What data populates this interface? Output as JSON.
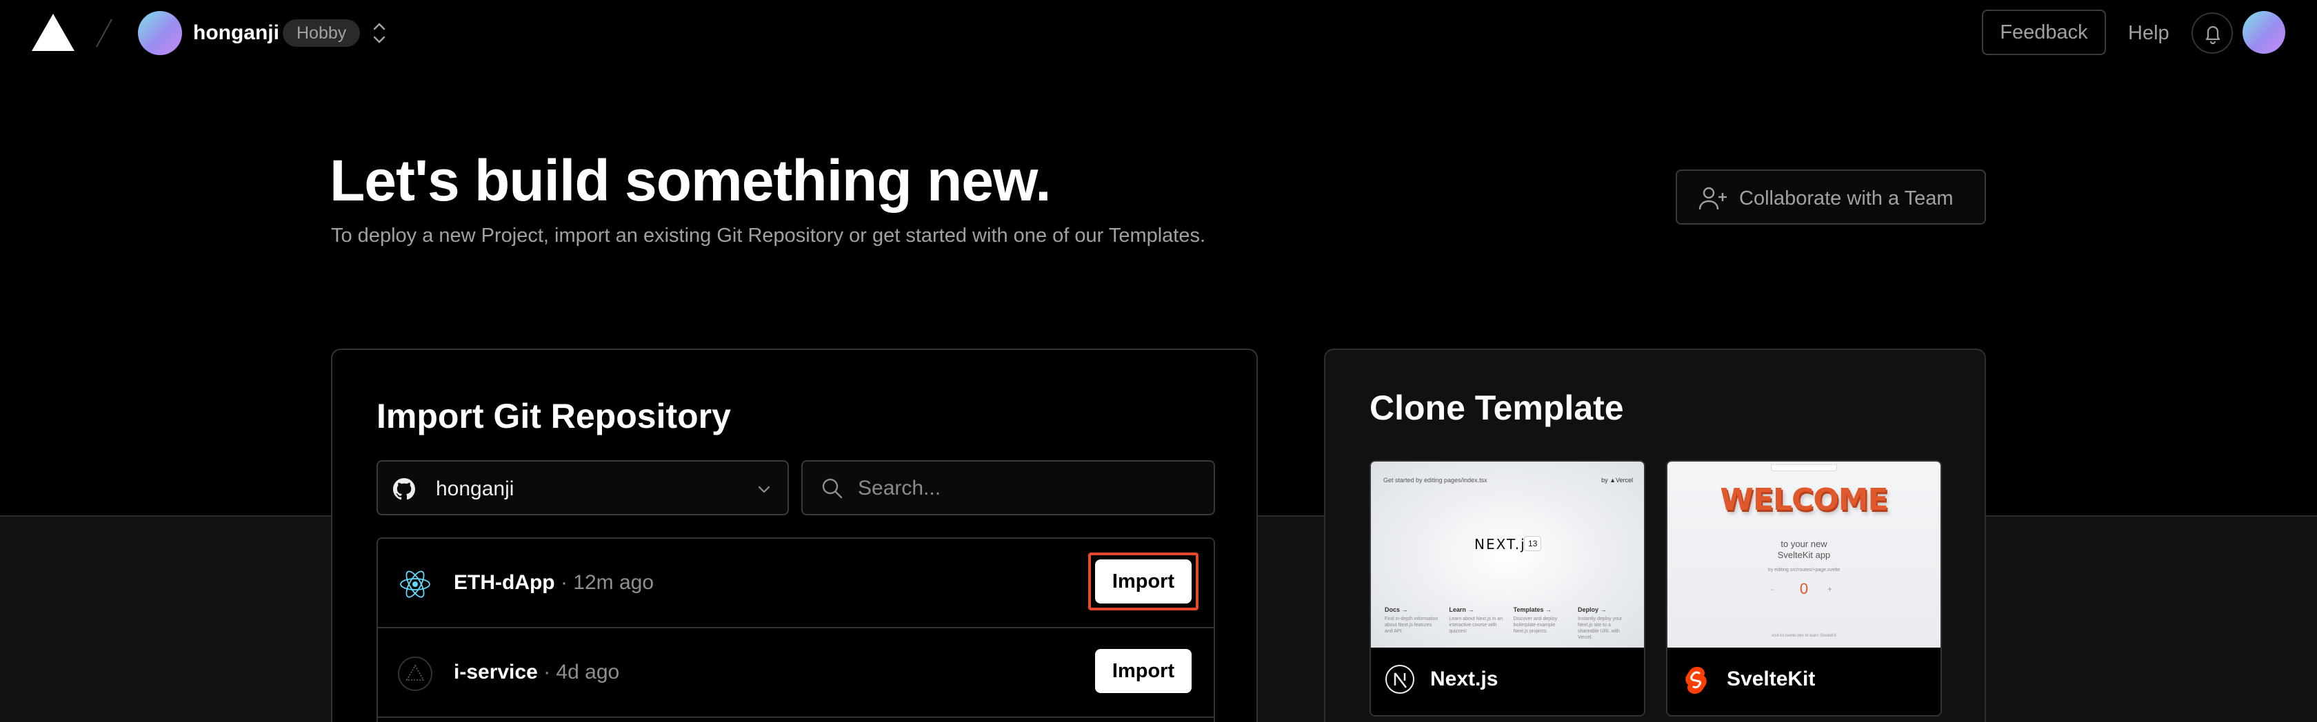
{
  "nav": {
    "user": "honganji",
    "plan": "Hobby",
    "feedback": "Feedback",
    "help": "Help"
  },
  "hero": {
    "title": "Let's build something new.",
    "subtitle": "To deploy a new Project, import an existing Git Repository or get started with one of our Templates.",
    "collab_button": "Collaborate with a Team"
  },
  "import": {
    "title": "Import Git Repository",
    "owner": "honganji",
    "search_placeholder": "Search...",
    "repos": [
      {
        "name": "ETH-dApp",
        "time": " · 12m ago",
        "icon": "react-icon",
        "button": "Import",
        "highlighted": true
      },
      {
        "name": "i-service",
        "time": " · 4d ago",
        "icon": "vercel-triangle-icon",
        "button": "Import",
        "highlighted": false
      }
    ]
  },
  "clone": {
    "title": "Clone Template",
    "templates": [
      {
        "name": "Next.js",
        "icon": "nextjs-icon",
        "preview": {
          "top": "Get started by editing pages/index.tsx",
          "by": "by ▲Vercel",
          "logo": "NEXT.js",
          "version": "13",
          "cols": [
            {
              "title": "Docs →",
              "text": "Find in-depth information about Next.js features and API."
            },
            {
              "title": "Learn →",
              "text": "Learn about Next.js in an interactive course with quizzes!"
            },
            {
              "title": "Templates →",
              "text": "Discover and deploy boilerplate example Next.js projects."
            },
            {
              "title": "Deploy →",
              "text": "Instantly deploy your Next.js site to a shareable URL with Vercel."
            }
          ]
        }
      },
      {
        "name": "SvelteKit",
        "icon": "svelte-icon",
        "preview": {
          "welcome": "WELCOME",
          "sub1": "to your new",
          "sub2": "SvelteKit app",
          "try": "try editing src/routes/+page.svelte",
          "count": "0",
          "minus": "-",
          "plus": "+",
          "foot": "visit kit.svelte.dev to learn SvelteKit"
        }
      }
    ]
  },
  "colors": {
    "background": "#000000",
    "card": "#111111",
    "highlight": "#e5482c",
    "svelte": "#ff3e00"
  }
}
